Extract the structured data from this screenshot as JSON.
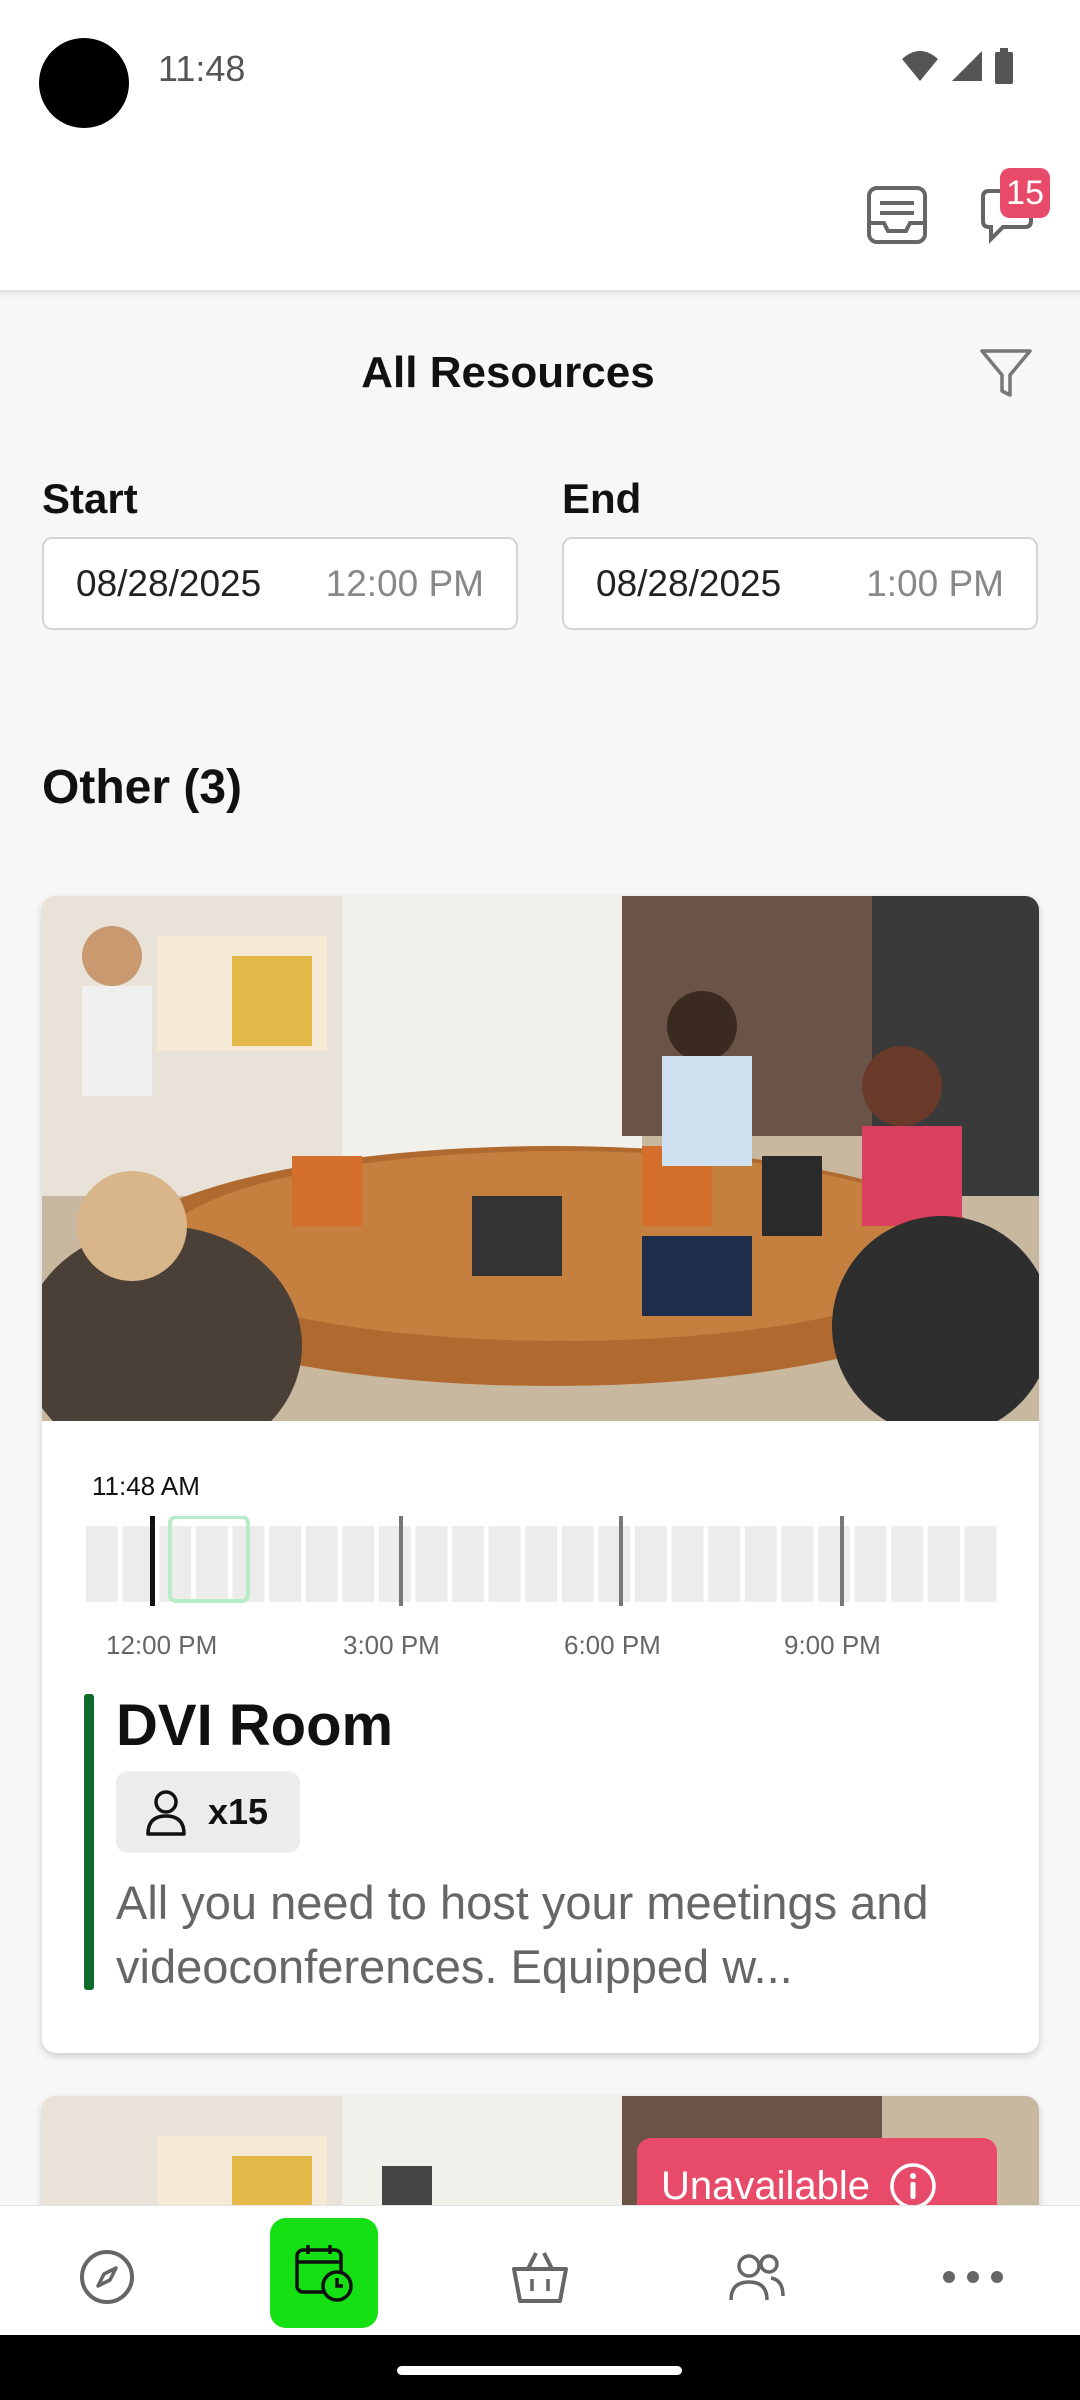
{
  "status_bar": {
    "time": "11:48"
  },
  "header": {
    "notification_count": "15"
  },
  "page": {
    "title": "All Resources"
  },
  "start": {
    "label": "Start",
    "date": "08/28/2025",
    "time": "12:00 PM"
  },
  "end": {
    "label": "End",
    "date": "08/28/2025",
    "time": "1:00 PM"
  },
  "section": {
    "title": "Other (3)"
  },
  "resource_card": {
    "current_time": "11:48 AM",
    "tick_labels": [
      "12:00 PM",
      "3:00 PM",
      "6:00 PM",
      "9:00 PM"
    ],
    "name": "DVI Room",
    "capacity": "x15",
    "description": "All you need to host your meetings and videoconferences. Equipped w...",
    "accent_color": "#0d6b2e"
  },
  "resource_card_2": {
    "status": "Unavailable"
  },
  "nav": {
    "items": [
      "explore-icon",
      "calendar-clock-icon",
      "basket-icon",
      "people-icon",
      "more-icon"
    ],
    "active": "calendar-clock-icon",
    "active_color": "#14e014"
  },
  "colors": {
    "badge": "#e84a6a",
    "accent_green": "#14e014"
  }
}
